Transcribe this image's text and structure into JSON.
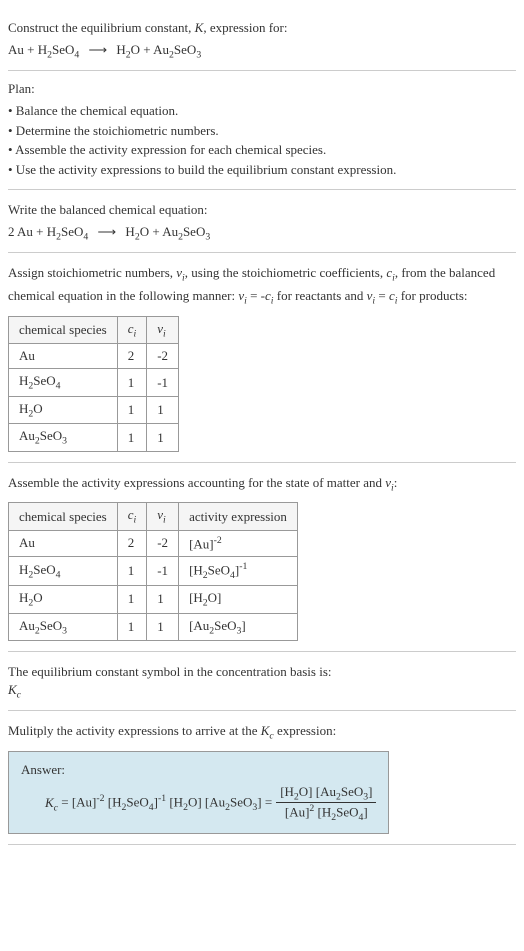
{
  "intro": {
    "line1": "Construct the equilibrium constant, K, expression for:",
    "equation": "Au + H₂SeO₄ ⟶ H₂O + Au₂SeO₃"
  },
  "plan": {
    "title": "Plan:",
    "items": [
      "• Balance the chemical equation.",
      "• Determine the stoichiometric numbers.",
      "• Assemble the activity expression for each chemical species.",
      "• Use the activity expressions to build the equilibrium constant expression."
    ]
  },
  "balanced": {
    "title": "Write the balanced chemical equation:",
    "equation": "2 Au + H₂SeO₄ ⟶ H₂O + Au₂SeO₃"
  },
  "stoich": {
    "desc": "Assign stoichiometric numbers, νᵢ, using the stoichiometric coefficients, cᵢ, from the balanced chemical equation in the following manner: νᵢ = -cᵢ for reactants and νᵢ = cᵢ for products:",
    "headers": [
      "chemical species",
      "cᵢ",
      "νᵢ"
    ],
    "rows": [
      [
        "Au",
        "2",
        "-2"
      ],
      [
        "H₂SeO₄",
        "1",
        "-1"
      ],
      [
        "H₂O",
        "1",
        "1"
      ],
      [
        "Au₂SeO₃",
        "1",
        "1"
      ]
    ]
  },
  "activity": {
    "desc": "Assemble the activity expressions accounting for the state of matter and νᵢ:",
    "headers": [
      "chemical species",
      "cᵢ",
      "νᵢ",
      "activity expression"
    ],
    "rows": [
      [
        "Au",
        "2",
        "-2",
        "[Au]⁻²"
      ],
      [
        "H₂SeO₄",
        "1",
        "-1",
        "[H₂SeO₄]⁻¹"
      ],
      [
        "H₂O",
        "1",
        "1",
        "[H₂O]"
      ],
      [
        "Au₂SeO₃",
        "1",
        "1",
        "[Au₂SeO₃]"
      ]
    ]
  },
  "symbol": {
    "line1": "The equilibrium constant symbol in the concentration basis is:",
    "line2": "K_c"
  },
  "multiply": {
    "desc": "Mulitply the activity expressions to arrive at the K_c expression:"
  },
  "answer": {
    "label": "Answer:",
    "lhs": "K_c = [Au]⁻² [H₂SeO₄]⁻¹ [H₂O] [Au₂SeO₃] =",
    "frac_num": "[H₂O] [Au₂SeO₃]",
    "frac_den": "[Au]² [H₂SeO₄]"
  },
  "chart_data": {
    "type": "table",
    "tables": [
      {
        "title": "Stoichiometric numbers",
        "headers": [
          "chemical species",
          "c_i",
          "ν_i"
        ],
        "rows": [
          {
            "species": "Au",
            "c": 2,
            "nu": -2
          },
          {
            "species": "H₂SeO₄",
            "c": 1,
            "nu": -1
          },
          {
            "species": "H₂O",
            "c": 1,
            "nu": 1
          },
          {
            "species": "Au₂SeO₃",
            "c": 1,
            "nu": 1
          }
        ]
      },
      {
        "title": "Activity expressions",
        "headers": [
          "chemical species",
          "c_i",
          "ν_i",
          "activity expression"
        ],
        "rows": [
          {
            "species": "Au",
            "c": 2,
            "nu": -2,
            "activity": "[Au]^-2"
          },
          {
            "species": "H₂SeO₄",
            "c": 1,
            "nu": -1,
            "activity": "[H₂SeO₄]^-1"
          },
          {
            "species": "H₂O",
            "c": 1,
            "nu": 1,
            "activity": "[H₂O]"
          },
          {
            "species": "Au₂SeO₃",
            "c": 1,
            "nu": 1,
            "activity": "[Au₂SeO₃]"
          }
        ]
      }
    ]
  }
}
